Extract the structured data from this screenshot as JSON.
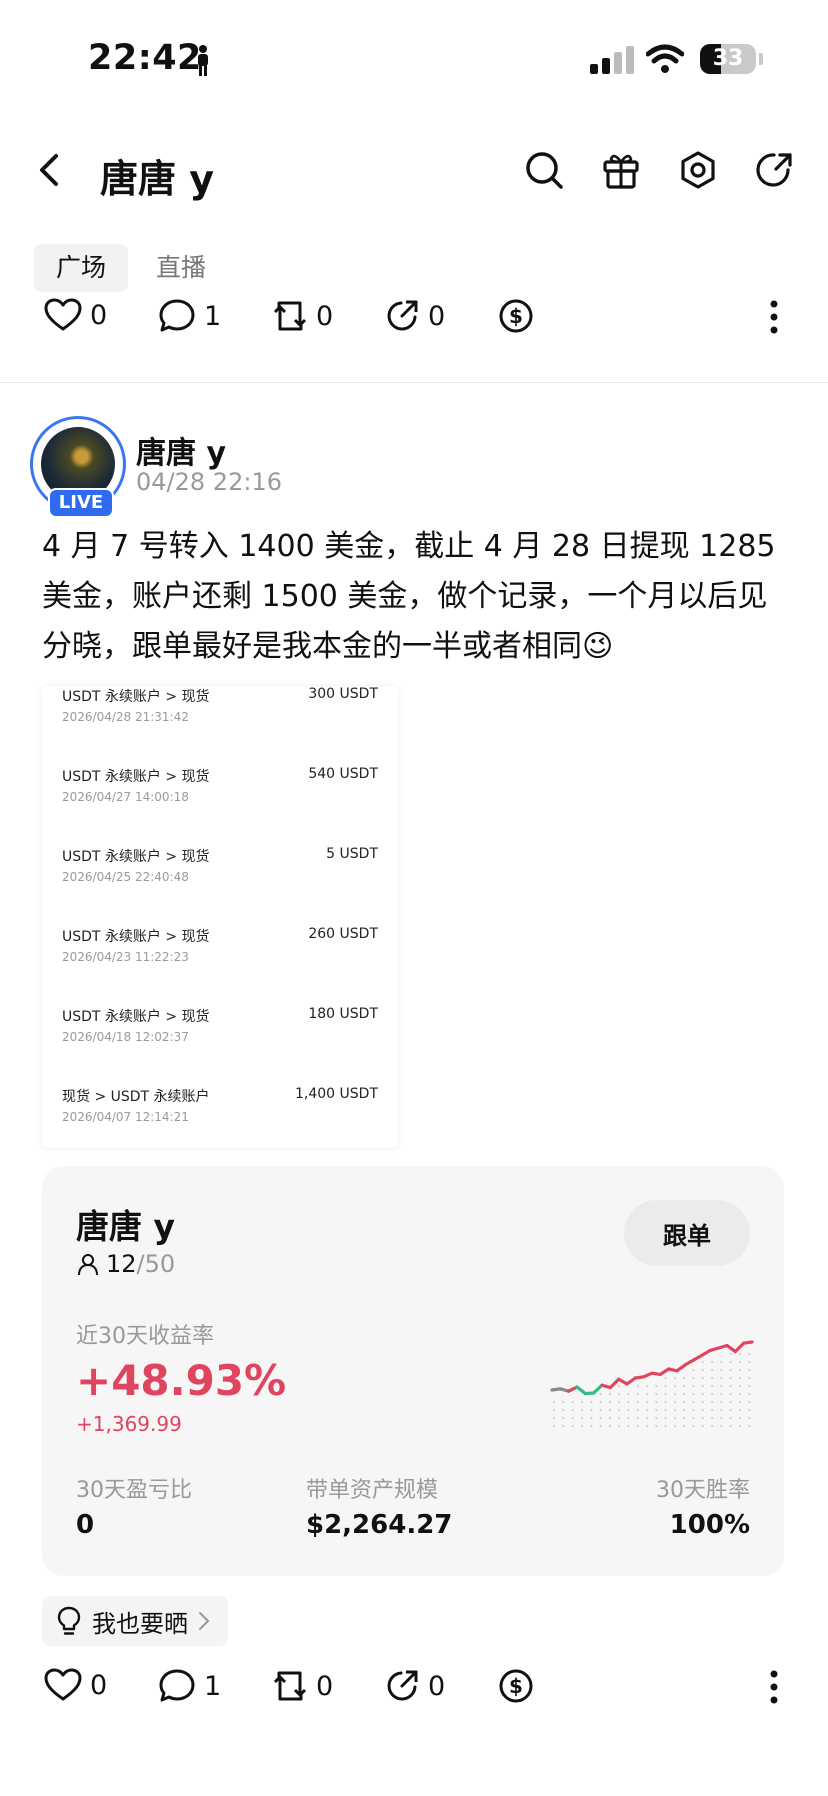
{
  "status_bar": {
    "time": "22:42",
    "battery": "33"
  },
  "header": {
    "title": "唐唐 y"
  },
  "tabs": [
    {
      "label": "广场"
    },
    {
      "label": "直播"
    }
  ],
  "top_actions": {
    "likes": "0",
    "comments": "1",
    "reposts": "0",
    "shares": "0"
  },
  "post": {
    "author": "唐唐 y",
    "time": "04/28 22:16",
    "live_badge": "LIVE",
    "text": "4 月 7 号转入 1400 美金，截止 4 月 28 日提现 1285 美金，账户还剩 1500 美金，做个记录，一个月以后见分晓，跟单最好是我本金的一半或者相同😉",
    "transfers": [
      {
        "label": "USDT 永续账户 > 现货",
        "amount": "300 USDT",
        "date": "2026/04/28 21:31:42"
      },
      {
        "label": "USDT 永续账户 > 现货",
        "amount": "540 USDT",
        "date": "2026/04/27 14:00:18"
      },
      {
        "label": "USDT 永续账户 > 现货",
        "amount": "5 USDT",
        "date": "2026/04/25 22:40:48"
      },
      {
        "label": "USDT 永续账户 > 现货",
        "amount": "260 USDT",
        "date": "2026/04/23 11:22:23"
      },
      {
        "label": "USDT 永续账户 > 现货",
        "amount": "180 USDT",
        "date": "2026/04/18 12:02:37"
      },
      {
        "label": "现货 > USDT 永续账户",
        "amount": "1,400 USDT",
        "date": "2026/04/07 12:14:21"
      }
    ]
  },
  "trader_card": {
    "name": "唐唐 y",
    "follow_label": "跟单",
    "followers": "12",
    "followers_max": "/50",
    "return_label": "近30天收益率",
    "return_pct": "+48.93%",
    "return_abs": "+1,369.99",
    "stats": [
      {
        "label": "30天盈亏比",
        "value": "0"
      },
      {
        "label": "带单资产规模",
        "value": "$2,264.27"
      },
      {
        "label": "30天胜率",
        "value": "100%"
      }
    ],
    "sparkline": [
      0.2,
      0.22,
      0.18,
      0.25,
      0.14,
      0.15,
      0.28,
      0.24,
      0.38,
      0.3,
      0.4,
      0.42,
      0.48,
      0.46,
      0.55,
      0.52,
      0.62,
      0.7,
      0.78,
      0.86,
      0.9,
      0.94,
      0.84,
      0.98,
      1.0
    ],
    "colors": {
      "up": "#e0455f",
      "down": "#2dbd85"
    }
  },
  "share_chip": {
    "label": "我也要晒"
  },
  "bottom_actions": {
    "likes": "0",
    "comments": "1",
    "reposts": "0",
    "shares": "0"
  }
}
